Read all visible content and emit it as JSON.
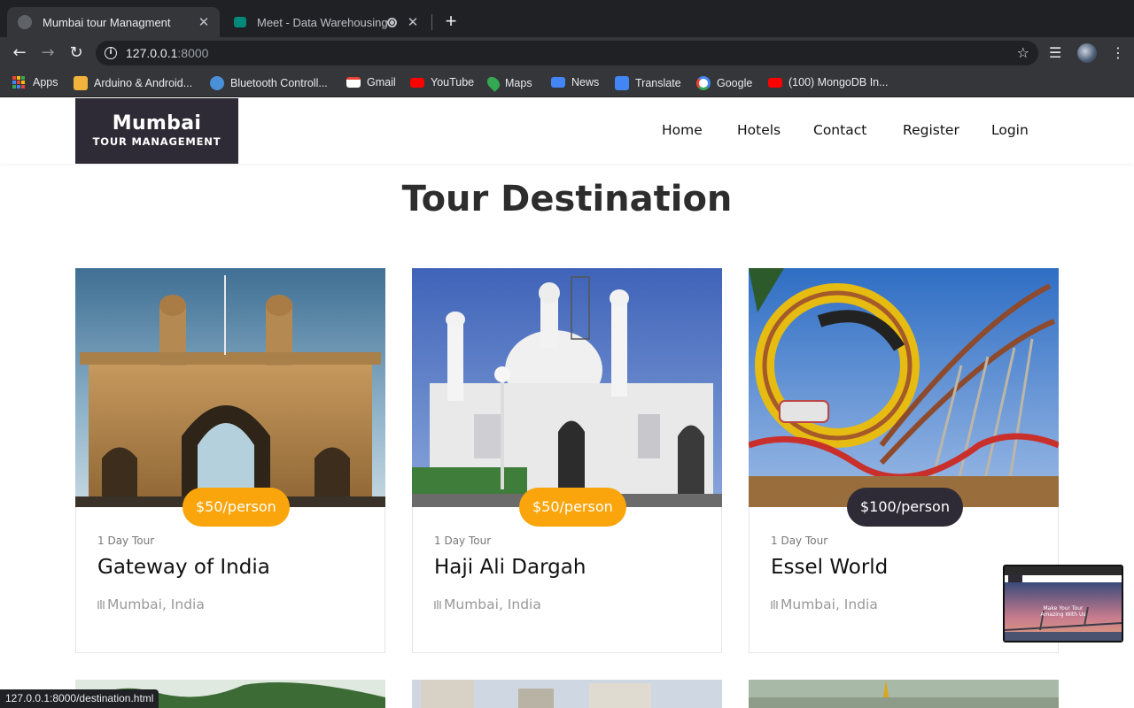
{
  "browser": {
    "tabs": [
      {
        "title": "Mumbai tour Managment",
        "active": true
      },
      {
        "title": "Meet - Data Warehousing a",
        "active": false
      }
    ],
    "url_host": "127.0.0.1",
    "url_port": ":8000",
    "bookmarks": [
      {
        "label": "Apps",
        "icon": "apps-grid-icon"
      },
      {
        "label": "Arduino & Android...",
        "icon": "arduino-icon",
        "color": "#f2b33d"
      },
      {
        "label": "Bluetooth Controll...",
        "icon": "globe-icon",
        "color": "#4a90d9"
      },
      {
        "label": "Gmail",
        "icon": "gmail-icon",
        "color": "#ea4335"
      },
      {
        "label": "YouTube",
        "icon": "youtube-icon",
        "color": "#ff0000"
      },
      {
        "label": "Maps",
        "icon": "maps-icon",
        "color": "#34a853"
      },
      {
        "label": "News",
        "icon": "news-icon",
        "color": "#4285f4"
      },
      {
        "label": "Translate",
        "icon": "translate-icon",
        "color": "#4285f4"
      },
      {
        "label": "Google",
        "icon": "google-icon",
        "color": "#ffffff"
      },
      {
        "label": "(100) MongoDB In...",
        "icon": "youtube-icon",
        "color": "#ff0000"
      }
    ],
    "status_url": "127.0.0.1:8000/destination.html"
  },
  "site": {
    "logo": {
      "line1": "Mumbai",
      "line2": "TOUR MANAGEMENT"
    },
    "nav": [
      "Home",
      "Hotels",
      "Contact",
      "Register",
      "Login"
    ],
    "page_title": "Tour Destination",
    "accent_color": "#f9a50b",
    "dark_color": "#2f2b36",
    "destinations": [
      {
        "price": "$50/person",
        "price_style": "yellow",
        "duration": "1 Day Tour",
        "name": "Gateway of India",
        "location": "Mumbai, India"
      },
      {
        "price": "$50/person",
        "price_style": "yellow",
        "duration": "1 Day Tour",
        "name": "Haji Ali Dargah",
        "location": "Mumbai, India"
      },
      {
        "price": "$100/person",
        "price_style": "dark",
        "duration": "1 Day Tour",
        "name": "Essel World",
        "location": "Mumbai, India"
      }
    ],
    "pip_caption": "Make Your Tour Amazing With Us"
  }
}
